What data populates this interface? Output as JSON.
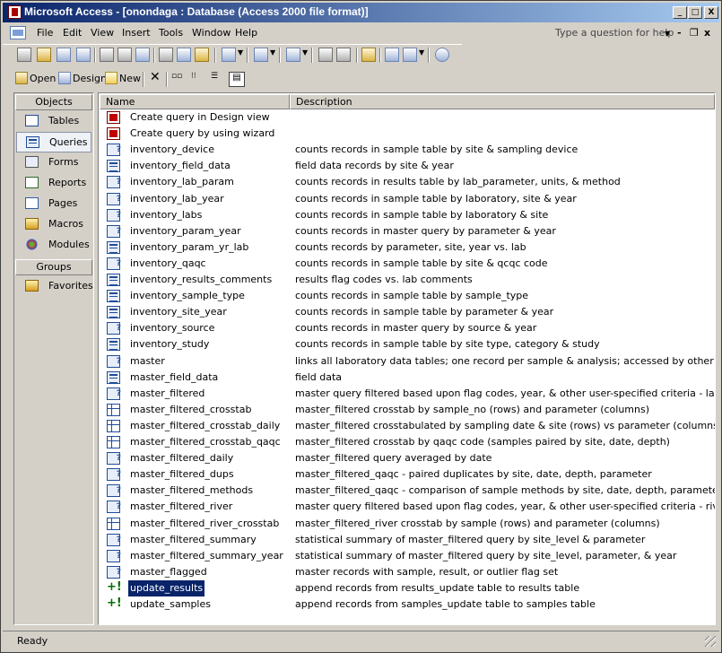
{
  "window": {
    "title": "Microsoft Access - [onondaga : Database (Access 2000 file format)]",
    "controls": {
      "minimize": "_",
      "maximize": "□",
      "close": "X"
    }
  },
  "menu": {
    "items": [
      "File",
      "Edit",
      "View",
      "Insert",
      "Tools",
      "Window",
      "Help"
    ],
    "help_placeholder": "Type a question for help",
    "mdi_controls": {
      "minimize": "-",
      "restore": "❐",
      "close": "x"
    }
  },
  "db_toolbar": {
    "open_label": "Open",
    "design_label": "Design",
    "new_label": "New"
  },
  "objects_pane": {
    "header": "Objects",
    "items": [
      "Tables",
      "Queries",
      "Forms",
      "Reports",
      "Pages",
      "Macros",
      "Modules"
    ],
    "selected": "Queries",
    "groups_header": "Groups",
    "groups": [
      "Favorites"
    ]
  },
  "list": {
    "columns": {
      "name": "Name",
      "description": "Description"
    },
    "rows": [
      {
        "icon": "design",
        "name": "Create query in Design view",
        "desc": ""
      },
      {
        "icon": "design",
        "name": "Create query by using wizard",
        "desc": ""
      },
      {
        "icon": "param",
        "name": "inventory_device",
        "desc": "counts records in sample table by site & sampling device"
      },
      {
        "icon": "select",
        "name": "inventory_field_data",
        "desc": "field data records by site & year"
      },
      {
        "icon": "param",
        "name": "inventory_lab_param",
        "desc": "counts records in results table by lab_parameter, units, & method"
      },
      {
        "icon": "param",
        "name": "inventory_lab_year",
        "desc": "counts records in sample table by laboratory, site & year"
      },
      {
        "icon": "param",
        "name": "inventory_labs",
        "desc": "counts records in sample table by laboratory & site"
      },
      {
        "icon": "param",
        "name": "inventory_param_year",
        "desc": "counts records in master query by parameter & year"
      },
      {
        "icon": "select",
        "name": "inventory_param_yr_lab",
        "desc": "counts records by parameter, site, year vs. lab"
      },
      {
        "icon": "param",
        "name": "inventory_qaqc",
        "desc": "counts records in sample table by site & qcqc code"
      },
      {
        "icon": "select",
        "name": "inventory_results_comments",
        "desc": "results flag codes vs. lab comments"
      },
      {
        "icon": "select",
        "name": "inventory_sample_type",
        "desc": "counts records in sample table by sample_type"
      },
      {
        "icon": "select",
        "name": "inventory_site_year",
        "desc": "counts records in sample table by parameter & year"
      },
      {
        "icon": "param",
        "name": "inventory_source",
        "desc": "counts records in master query by source & year"
      },
      {
        "icon": "select",
        "name": "inventory_study",
        "desc": "counts records in sample table by site type, category &  study"
      },
      {
        "icon": "param",
        "name": "master",
        "desc": "links all laboratory data tables; one record per sample & analysis; accessed by other queries"
      },
      {
        "icon": "select",
        "name": "master_field_data",
        "desc": "field data"
      },
      {
        "icon": "param",
        "name": "master_filtered",
        "desc": "master query filtered based upon flag codes, year, & other user-specified criteria - lake & trib sites"
      },
      {
        "icon": "xtab",
        "name": "master_filtered_crosstab",
        "desc": "master_filtered crosstab by sample_no (rows) and parameter (columns)"
      },
      {
        "icon": "xtab",
        "name": "master_filtered_crosstab_daily",
        "desc": "master_filtered crosstabulated by sampling date & site (rows) vs parameter (columns)"
      },
      {
        "icon": "xtab",
        "name": "master_filtered_crosstab_qaqc",
        "desc": "master_filtered crosstab by qaqc code (samples paired by site, date, depth)"
      },
      {
        "icon": "param",
        "name": "master_filtered_daily",
        "desc": "master_filtered query averaged by date"
      },
      {
        "icon": "param",
        "name": "master_filtered_dups",
        "desc": "master_filtered_qaqc - paired duplicates by site, date, depth, parameter"
      },
      {
        "icon": "param",
        "name": "master_filtered_methods",
        "desc": "master_filtered_qaqc - comparison of sample methods by site, date, depth, parameter"
      },
      {
        "icon": "param",
        "name": "master_filtered_river",
        "desc": "master query filtered based upon flag codes, year, & other user-specified criteria - river sites only"
      },
      {
        "icon": "xtab",
        "name": "master_filtered_river_crosstab",
        "desc": "master_filtered_river crosstab by sample (rows) and parameter (columns)"
      },
      {
        "icon": "param",
        "name": "master_filtered_summary",
        "desc": "statistical summary of master_filtered query by site_level & parameter"
      },
      {
        "icon": "param",
        "name": "master_filtered_summary_year",
        "desc": "statistical summary of master_filtered query by site_level, parameter, & year"
      },
      {
        "icon": "param",
        "name": "master_flagged",
        "desc": "master records with sample, result, or outlier flag set"
      },
      {
        "icon": "append",
        "name": "update_results",
        "desc": "append records from results_update table to results table",
        "selected": true
      },
      {
        "icon": "append",
        "name": "update_samples",
        "desc": "append records from samples_update table to samples table"
      }
    ]
  },
  "status": {
    "text": "Ready"
  }
}
